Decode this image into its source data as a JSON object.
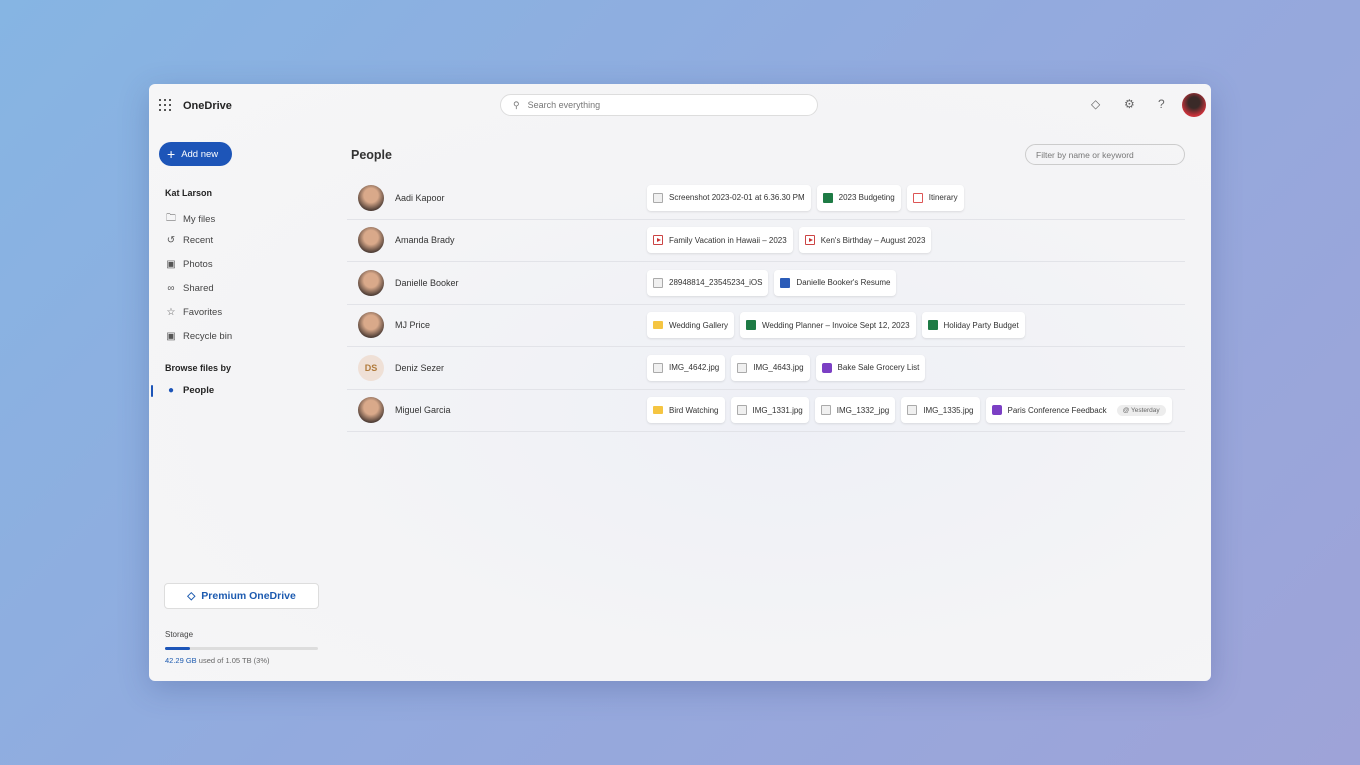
{
  "app": {
    "title": "OneDrive"
  },
  "search": {
    "placeholder": "Search everything"
  },
  "header_icons": [
    "diamond-icon",
    "gear-icon",
    "help-icon",
    "avatar"
  ],
  "sidebar": {
    "add_new": "Add new",
    "user": "Kat Larson",
    "items": [
      {
        "label": "My files",
        "icon": "folder-icon"
      },
      {
        "label": "Recent",
        "icon": "history-icon"
      },
      {
        "label": "Photos",
        "icon": "photo-icon"
      },
      {
        "label": "Shared",
        "icon": "people-icon"
      },
      {
        "label": "Favorites",
        "icon": "star-icon"
      },
      {
        "label": "Recycle bin",
        "icon": "recycle-bin-icon"
      }
    ],
    "browse_label": "Browse files by",
    "browse_item": "People",
    "premium": "Premium OneDrive",
    "storage": {
      "label": "Storage",
      "used": "42.29 GB",
      "rest": " used of 1.05 TB (3%)",
      "used_percent": 3
    }
  },
  "main": {
    "title": "People",
    "filter_placeholder": "Filter by name or keyword",
    "people": [
      {
        "name": "Aadi Kapoor",
        "files": [
          {
            "name": "Screenshot 2023-02-01 at 6.36.30 PM",
            "type": "image"
          },
          {
            "name": "2023 Budgeting",
            "type": "excel"
          },
          {
            "name": "Itinerary",
            "type": "pdf"
          }
        ]
      },
      {
        "name": "Amanda Brady",
        "files": [
          {
            "name": "Family Vacation in Hawaii – 2023",
            "type": "video"
          },
          {
            "name": "Ken's Birthday – August 2023",
            "type": "video"
          }
        ]
      },
      {
        "name": "Danielle Booker",
        "files": [
          {
            "name": "28948814_23545234_iOS",
            "type": "image"
          },
          {
            "name": "Danielle Booker's Resume",
            "type": "word"
          }
        ]
      },
      {
        "name": "MJ Price",
        "files": [
          {
            "name": "Wedding Gallery",
            "type": "folder"
          },
          {
            "name": "Wedding Planner – Invoice Sept 12, 2023",
            "type": "excel"
          },
          {
            "name": "Holiday Party Budget",
            "type": "excel"
          }
        ]
      },
      {
        "name": "Deniz Sezer",
        "initials": "DS",
        "files": [
          {
            "name": "IMG_4642.jpg",
            "type": "image"
          },
          {
            "name": "IMG_4643.jpg",
            "type": "image"
          },
          {
            "name": "Bake Sale Grocery List",
            "type": "onenote"
          }
        ]
      },
      {
        "name": "Miguel Garcia",
        "files": [
          {
            "name": "Bird Watching",
            "type": "folder"
          },
          {
            "name": "IMG_1331.jpg",
            "type": "image"
          },
          {
            "name": "IMG_1332_jpg",
            "type": "image"
          },
          {
            "name": "IMG_1335.jpg",
            "type": "image"
          },
          {
            "name": "Paris Conference Feedback",
            "type": "onenote",
            "badge": "@ Yesterday"
          }
        ]
      }
    ]
  }
}
